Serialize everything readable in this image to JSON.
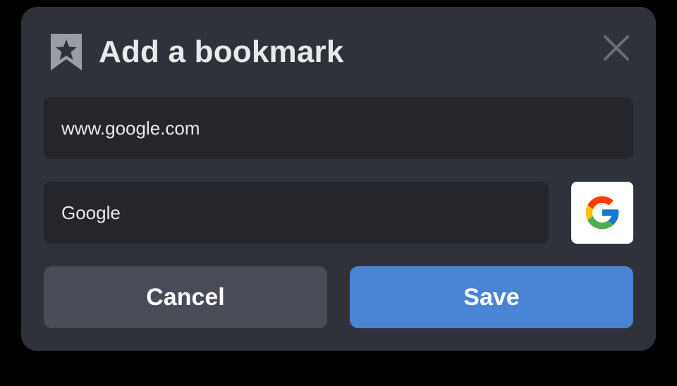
{
  "dialog": {
    "title": "Add a bookmark",
    "icons": {
      "title_icon": "bookmark-star-icon",
      "close_icon": "close-icon",
      "favicon": "google-logo"
    },
    "url_field": {
      "value": "www.google.com"
    },
    "name_field": {
      "value": "Google"
    },
    "cancel_label": "Cancel",
    "save_label": "Save"
  },
  "colors": {
    "background": "#000000",
    "dialog": "#2f323a",
    "field": "#24262b",
    "text": "#e8e9eb",
    "cancel_button": "#494c56",
    "save_button": "#4a84d4",
    "icon_muted": "#9a9da4",
    "close_icon": "#6a6d75"
  }
}
